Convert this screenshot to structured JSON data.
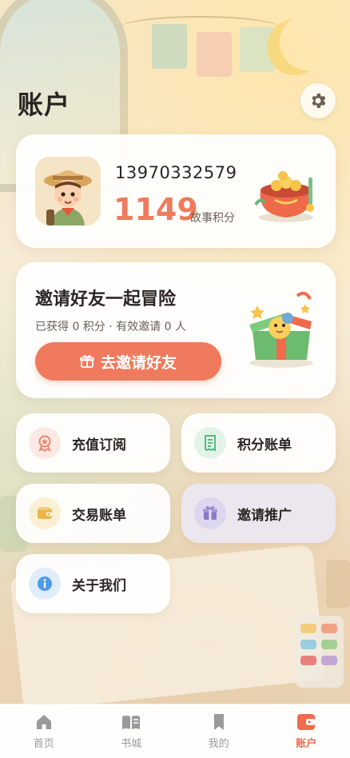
{
  "header": {
    "title": "账户",
    "settings_icon": "gear-icon"
  },
  "profile": {
    "phone": "13970332579",
    "points": "1149",
    "points_unit": "故事积分",
    "avatar_icon": "explorer-kid-avatar",
    "decoration_icon": "treasure-pot-icon"
  },
  "invite": {
    "title": "邀请好友一起冒险",
    "stats": "已获得 0 积分 · 有效邀请 0 人",
    "button_label": "去邀请好友",
    "button_icon": "gift-box-icon",
    "decoration_icon": "gift-box-illustration"
  },
  "menu": [
    {
      "label": "充值订阅",
      "icon": "medal-icon",
      "color": "#f2826a",
      "bg": "#fde9e3"
    },
    {
      "label": "积分账单",
      "icon": "receipt-icon",
      "color": "#4fae77",
      "bg": "#e2f3e8"
    },
    {
      "label": "交易账单",
      "icon": "wallet-icon",
      "color": "#eab64a",
      "bg": "#fcf0d4"
    },
    {
      "label": "邀请推广",
      "icon": "gift-icon",
      "color": "#8a7ac9",
      "bg": "#e5e0f3"
    },
    {
      "label": "关于我们",
      "icon": "info-icon",
      "color": "#4f9ae8",
      "bg": "#e0edfb"
    }
  ],
  "nav": [
    {
      "label": "首页",
      "icon": "home-icon",
      "active": false
    },
    {
      "label": "书城",
      "icon": "book-open-icon",
      "active": false
    },
    {
      "label": "我的",
      "icon": "bookmark-icon",
      "active": false
    },
    {
      "label": "账户",
      "icon": "wallet-icon",
      "active": true
    }
  ],
  "colors": {
    "accent": "#f07a5e",
    "points": "#ef7b5c",
    "nav_active": "#ef6c4e",
    "nav_inactive": "#9a9a9a"
  }
}
